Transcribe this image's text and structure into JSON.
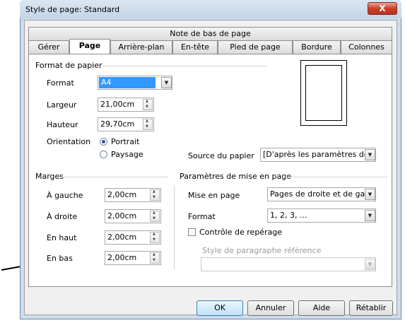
{
  "window": {
    "title": "Style de page: Standard",
    "close_glyph": "X"
  },
  "tabs_top": [
    "Note de bas de page"
  ],
  "tabs": [
    "Gérer",
    "Page",
    "Arrière-plan",
    "En-tête",
    "Pied de page",
    "Bordure",
    "Colonnes"
  ],
  "format_papier": {
    "heading": "Format de papier",
    "format_label": "Format",
    "format_value": "A4",
    "largeur_label": "Largeur",
    "largeur_value": "21,00cm",
    "hauteur_label": "Hauteur",
    "hauteur_value": "29,70cm",
    "orientation_label": "Orientation",
    "portrait": "Portrait",
    "paysage": "Paysage",
    "orientation_selected": "Portrait",
    "source_label": "Source du papier",
    "source_value": "[D'après les paramètres de l'"
  },
  "marges": {
    "heading": "Marges",
    "gauche_label": "À gauche",
    "gauche_value": "2,00cm",
    "droite_label": "À droite",
    "droite_value": "2,00cm",
    "haut_label": "En haut",
    "haut_value": "2,00cm",
    "bas_label": "En bas",
    "bas_value": "2,00cm"
  },
  "mise_en_page": {
    "heading": "Paramètres de mise en page",
    "mise_label": "Mise en page",
    "mise_value": "Pages de droite et de gauc",
    "format_label": "Format",
    "format_value": "1, 2, 3, ...",
    "controle_label": "Contrôle de repérage",
    "controle_checked": false,
    "style_ref_label": "Style de paragraphe référence",
    "style_ref_value": ""
  },
  "buttons": {
    "ok": "OK",
    "annuler": "Annuler",
    "aide": "Aide",
    "retablir": "Rétablir"
  },
  "colors": {
    "selection": "#3399ff",
    "accent": "#2b55a8",
    "close": "#c9402a"
  }
}
